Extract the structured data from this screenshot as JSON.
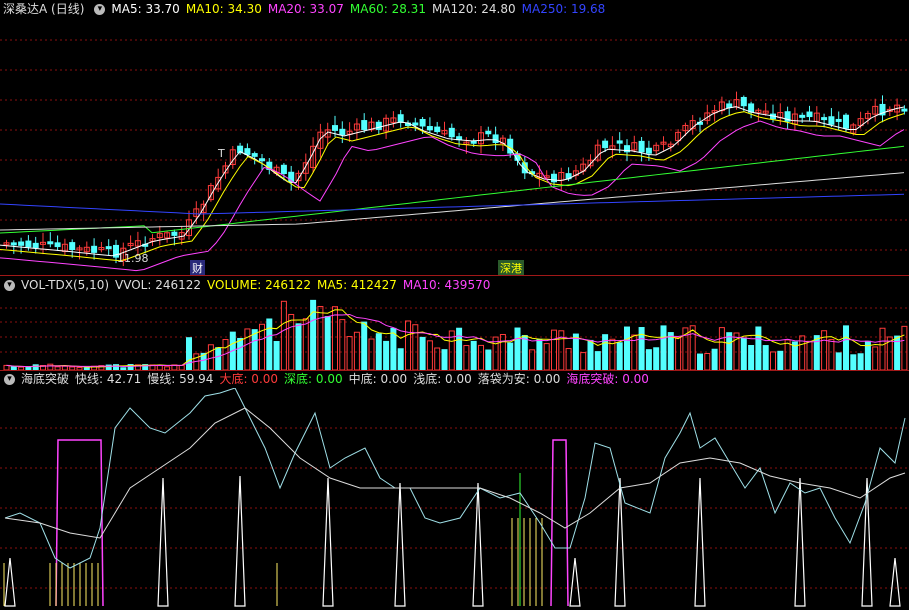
{
  "price_panel": {
    "title": "深桑达A (日线)",
    "indicators": [
      {
        "label": "MA5: 33.70",
        "color": "#ffffff"
      },
      {
        "label": "MA10: 34.30",
        "color": "#ffff00"
      },
      {
        "label": "MA20: 33.07",
        "color": "#ff44ff"
      },
      {
        "label": "MA60: 28.31",
        "color": "#33ff33"
      },
      {
        "label": "MA120: 24.80",
        "color": "#dddddd"
      },
      {
        "label": "MA250: 19.68",
        "color": "#3344ff"
      }
    ],
    "low_label": "11.98",
    "high_marker": "T",
    "event_label_1": "财",
    "event_label_2": "深港",
    "colors": {
      "up": "#ff3b3b",
      "down": "#54ffff"
    }
  },
  "volume_panel": {
    "title": "VOL-TDX(5,10)",
    "indicators": [
      {
        "label": "VVOL: 246122",
        "color": "#dddddd"
      },
      {
        "label": "VOLUME: 246122",
        "color": "#ffff00"
      },
      {
        "label": "MA5: 412427",
        "color": "#ffff00"
      },
      {
        "label": "MA10: 439570",
        "color": "#ff44ff"
      }
    ]
  },
  "haidi_panel": {
    "title": "海底突破",
    "indicators": [
      {
        "label": "快线: 42.71",
        "color": "#dddddd"
      },
      {
        "label": "慢线: 59.94",
        "color": "#dddddd"
      },
      {
        "label": "大底: 0.00",
        "color": "#ff3b3b"
      },
      {
        "label": "深底: 0.00",
        "color": "#33ff33"
      },
      {
        "label": "中底: 0.00",
        "color": "#dddddd"
      },
      {
        "label": "浅底: 0.00",
        "color": "#dddddd"
      },
      {
        "label": "落袋为安: 0.00",
        "color": "#dddddd"
      },
      {
        "label": "海底突破: 0.00",
        "color": "#ff44ff"
      }
    ]
  }
}
